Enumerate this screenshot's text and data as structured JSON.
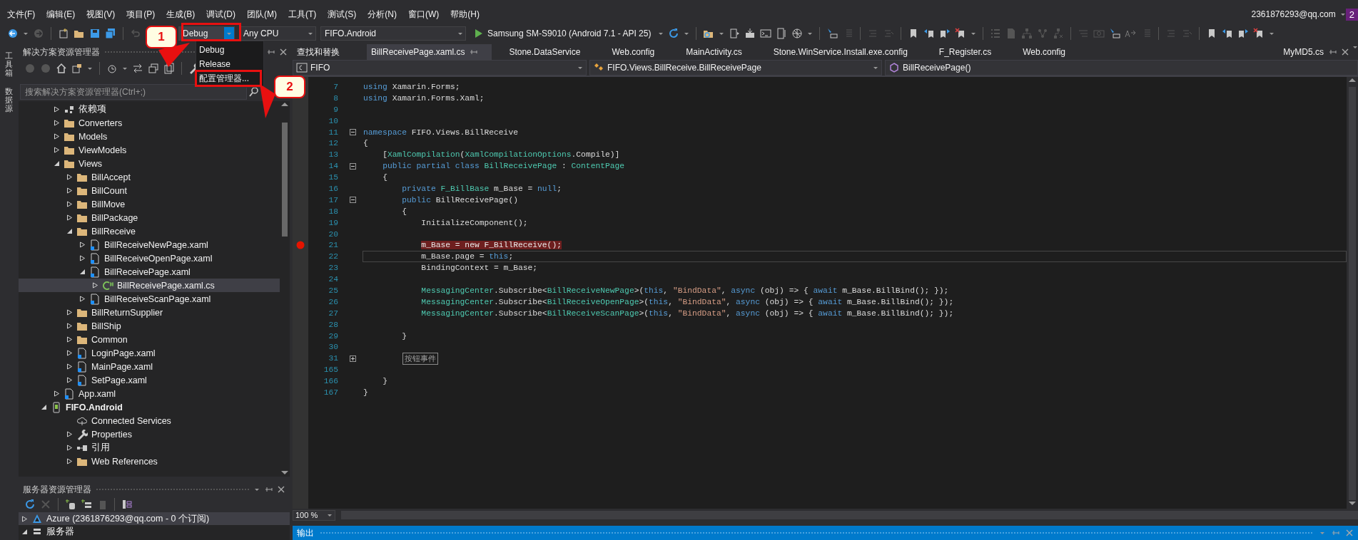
{
  "menu": [
    {
      "label": "文件(F)"
    },
    {
      "label": "编辑(E)"
    },
    {
      "label": "视图(V)"
    },
    {
      "label": "项目(P)"
    },
    {
      "label": "生成(B)"
    },
    {
      "label": "调试(D)"
    },
    {
      "label": "团队(M)"
    },
    {
      "label": "工具(T)"
    },
    {
      "label": "测试(S)"
    },
    {
      "label": "分析(N)"
    },
    {
      "label": "窗口(W)"
    },
    {
      "label": "帮助(H)"
    }
  ],
  "account": "2361876293@qq.com",
  "notification_badge": "2",
  "toolbar": {
    "configuration": "Debug",
    "platform": "Any CPU",
    "startup_project": "FIFO.Android",
    "run_target": "Samsung SM-S9010 (Android 7.1 - API 25)"
  },
  "config_menu": [
    {
      "label": "Debug",
      "framed": false
    },
    {
      "label": "Release",
      "framed": false
    },
    {
      "label": "配置管理器...",
      "framed": true
    }
  ],
  "callouts": [
    {
      "label": "1"
    },
    {
      "label": "2"
    }
  ],
  "side_strip": [
    {
      "label": "工具箱"
    },
    {
      "label": "数据源"
    }
  ],
  "solution_explorer": {
    "title": "解决方案资源管理器",
    "search": {
      "placeholder": "搜索解决方案资源管理器(Ctrl+;)"
    },
    "tree": [
      {
        "label": "依赖项",
        "kind": "deps",
        "expanded": false,
        "selected": false
      },
      {
        "label": "Converters",
        "kind": "folder",
        "expanded": false,
        "selected": false
      },
      {
        "label": "Models",
        "kind": "folder",
        "expanded": false,
        "selected": false
      },
      {
        "label": "ViewModels",
        "kind": "folder",
        "expanded": false,
        "selected": false
      },
      {
        "label": "Views",
        "kind": "folder",
        "expanded": true,
        "selected": false,
        "children": [
          {
            "label": "BillAccept",
            "kind": "folder",
            "expanded": false,
            "selected": false
          },
          {
            "label": "BillCount",
            "kind": "folder",
            "expanded": false,
            "selected": false
          },
          {
            "label": "BillMove",
            "kind": "folder",
            "expanded": false,
            "selected": false
          },
          {
            "label": "BillPackage",
            "kind": "folder",
            "expanded": false,
            "selected": false
          },
          {
            "label": "BillReceive",
            "kind": "folder",
            "expanded": true,
            "selected": false,
            "children": [
              {
                "label": "BillReceiveNewPage.xaml",
                "kind": "xaml",
                "expanded": false,
                "selected": false
              },
              {
                "label": "BillReceiveOpenPage.xaml",
                "kind": "xaml",
                "expanded": false,
                "selected": false
              },
              {
                "label": "BillReceivePage.xaml",
                "kind": "xaml",
                "expanded": true,
                "selected": false,
                "children": [
                  {
                    "label": "BillReceivePage.xaml.cs",
                    "kind": "csharp",
                    "expanded": false,
                    "selected": true
                  }
                ]
              },
              {
                "label": "BillReceiveScanPage.xaml",
                "kind": "xaml",
                "expanded": false,
                "selected": false
              }
            ]
          },
          {
            "label": "BillReturnSupplier",
            "kind": "folder",
            "expanded": false,
            "selected": false
          },
          {
            "label": "BillShip",
            "kind": "folder",
            "expanded": false,
            "selected": false
          },
          {
            "label": "Common",
            "kind": "folder",
            "expanded": false,
            "selected": false
          },
          {
            "label": "LoginPage.xaml",
            "kind": "xaml",
            "expanded": false,
            "selected": false
          },
          {
            "label": "MainPage.xaml",
            "kind": "xaml",
            "expanded": false,
            "selected": false
          },
          {
            "label": "SetPage.xaml",
            "kind": "xaml",
            "expanded": false,
            "selected": false
          }
        ]
      },
      {
        "label": "App.xaml",
        "kind": "xaml",
        "expanded": false,
        "selected": false
      },
      {
        "label": "FIFO.Android",
        "kind": "project",
        "expanded": true,
        "selected": false,
        "children": [
          {
            "label": "Connected Services",
            "kind": "cloud",
            "selected": false
          },
          {
            "label": "Properties",
            "kind": "wrench",
            "expanded": false,
            "selected": false
          },
          {
            "label": "引用",
            "kind": "refs",
            "expanded": false,
            "selected": false
          },
          {
            "label": "Web References",
            "kind": "folder",
            "expanded": false,
            "selected": false
          }
        ]
      }
    ]
  },
  "server_explorer": {
    "title": "服务器资源管理器",
    "tree": [
      {
        "label": "Azure (2361876293@qq.com - 0 个订阅)",
        "kind": "azure",
        "expanded": false,
        "selected": true
      },
      {
        "label": "服务器",
        "kind": "server",
        "expanded": true,
        "selected": false
      }
    ]
  },
  "editor": {
    "tabs": [
      {
        "label": "查找和替换",
        "selected": false,
        "pinned": false,
        "closable": false
      },
      {
        "label": "BillReceivePage.xaml.cs",
        "selected": true,
        "pinned": true,
        "closable": false
      },
      {
        "label": "Stone.DataService",
        "selected": false,
        "pinned": false,
        "closable": false
      },
      {
        "label": "Web.config",
        "selected": false,
        "pinned": false,
        "closable": false
      },
      {
        "label": "MainActivity.cs",
        "selected": false,
        "pinned": false,
        "closable": false
      },
      {
        "label": "Stone.WinService.Install.exe.config",
        "selected": false,
        "pinned": false,
        "closable": false
      },
      {
        "label": "F_Register.cs",
        "selected": false,
        "pinned": false,
        "closable": false
      },
      {
        "label": "Web.config",
        "selected": false,
        "pinned": false,
        "closable": false
      },
      {
        "label": "MyMD5.cs",
        "selected": false,
        "pinned": true,
        "closable": true
      }
    ],
    "nav": {
      "project": "FIFO",
      "type": "FIFO.Views.BillReceive.BillReceivePage",
      "member": "BillReceivePage()"
    },
    "lines": [
      {
        "number": "7",
        "breakpoint": false,
        "current": false,
        "tokens": [
          {
            "kind": "kw",
            "text": "using"
          },
          {
            "kind": "plain",
            "text": " Xamarin.Forms;"
          }
        ]
      },
      {
        "number": "8",
        "breakpoint": false,
        "current": false,
        "tokens": [
          {
            "kind": "kw",
            "text": "using"
          },
          {
            "kind": "plain",
            "text": " Xamarin.Forms.Xaml;"
          }
        ]
      },
      {
        "number": "9",
        "breakpoint": false,
        "current": false
      },
      {
        "number": "10",
        "breakpoint": false,
        "current": false
      },
      {
        "number": "11",
        "breakpoint": false,
        "current": false,
        "collapsed": false,
        "tokens": [
          {
            "kind": "kw",
            "text": "namespace"
          },
          {
            "kind": "plain",
            "text": " FIFO.Views.BillReceive"
          }
        ]
      },
      {
        "number": "12",
        "breakpoint": false,
        "current": false,
        "tokens": [
          {
            "kind": "plain",
            "text": "{"
          }
        ]
      },
      {
        "number": "13",
        "breakpoint": false,
        "current": false,
        "tokens": [
          {
            "kind": "plain",
            "text": "    ["
          },
          {
            "kind": "type",
            "text": "XamlCompilation"
          },
          {
            "kind": "plain",
            "text": "("
          },
          {
            "kind": "type",
            "text": "XamlCompilationOptions"
          },
          {
            "kind": "plain",
            "text": ".Compile)]"
          }
        ]
      },
      {
        "number": "14",
        "breakpoint": false,
        "current": false,
        "collapsed": false,
        "tokens": [
          {
            "kind": "kw",
            "text": "    public partial class"
          },
          {
            "kind": "type",
            "text": " BillReceivePage"
          },
          {
            "kind": "plain",
            "text": " : "
          },
          {
            "kind": "type",
            "text": "ContentPage"
          }
        ]
      },
      {
        "number": "15",
        "breakpoint": false,
        "current": false,
        "tokens": [
          {
            "kind": "plain",
            "text": "    {"
          }
        ]
      },
      {
        "number": "16",
        "breakpoint": false,
        "current": false,
        "tokens": [
          {
            "kind": "kw",
            "text": "        private"
          },
          {
            "kind": "type",
            "text": " F_BillBase"
          },
          {
            "kind": "plain",
            "text": " m_Base = "
          },
          {
            "kind": "kw",
            "text": "null"
          },
          {
            "kind": "plain",
            "text": ";"
          }
        ]
      },
      {
        "number": "17",
        "breakpoint": false,
        "current": false,
        "collapsed": false,
        "tokens": [
          {
            "kind": "kw",
            "text": "        public"
          },
          {
            "kind": "plain",
            "text": " BillReceivePage()"
          }
        ]
      },
      {
        "number": "18",
        "breakpoint": false,
        "current": false,
        "tokens": [
          {
            "kind": "plain",
            "text": "        {"
          }
        ]
      },
      {
        "number": "19",
        "breakpoint": false,
        "current": false,
        "tokens": [
          {
            "kind": "plain",
            "text": "            InitializeComponent();"
          }
        ]
      },
      {
        "number": "20",
        "breakpoint": false,
        "current": false
      },
      {
        "number": "21",
        "breakpoint": true,
        "current": false,
        "tokens": [
          {
            "kind": "hl",
            "text": "            m_Base = new F_BillReceive();"
          }
        ]
      },
      {
        "number": "22",
        "breakpoint": false,
        "current": true,
        "tokens": [
          {
            "kind": "plain",
            "text": "            m_Base.page = "
          },
          {
            "kind": "kw",
            "text": "this"
          },
          {
            "kind": "plain",
            "text": ";"
          }
        ]
      },
      {
        "number": "23",
        "breakpoint": false,
        "current": false,
        "tokens": [
          {
            "kind": "plain",
            "text": "            BindingContext = m_Base;"
          }
        ]
      },
      {
        "number": "24",
        "breakpoint": false,
        "current": false
      },
      {
        "number": "25",
        "breakpoint": false,
        "current": false,
        "tokens": [
          {
            "kind": "type",
            "text": "            MessagingCenter"
          },
          {
            "kind": "plain",
            "text": ".Subscribe<"
          },
          {
            "kind": "type",
            "text": "BillReceiveNewPage"
          },
          {
            "kind": "plain",
            "text": ">("
          },
          {
            "kind": "kw",
            "text": "this"
          },
          {
            "kind": "plain",
            "text": ", "
          },
          {
            "kind": "str",
            "text": "\"BindData\""
          },
          {
            "kind": "plain",
            "text": ", "
          },
          {
            "kind": "kw",
            "text": "async"
          },
          {
            "kind": "plain",
            "text": " (obj) => { "
          },
          {
            "kind": "kw",
            "text": "await"
          },
          {
            "kind": "plain",
            "text": " m_Base.BillBind(); });"
          }
        ]
      },
      {
        "number": "26",
        "breakpoint": false,
        "current": false,
        "tokens": [
          {
            "kind": "type",
            "text": "            MessagingCenter"
          },
          {
            "kind": "plain",
            "text": ".Subscribe<"
          },
          {
            "kind": "type",
            "text": "BillReceiveOpenPage"
          },
          {
            "kind": "plain",
            "text": ">("
          },
          {
            "kind": "kw",
            "text": "this"
          },
          {
            "kind": "plain",
            "text": ", "
          },
          {
            "kind": "str",
            "text": "\"BindData\""
          },
          {
            "kind": "plain",
            "text": ", "
          },
          {
            "kind": "kw",
            "text": "async"
          },
          {
            "kind": "plain",
            "text": " (obj) => { "
          },
          {
            "kind": "kw",
            "text": "await"
          },
          {
            "kind": "plain",
            "text": " m_Base.BillBind(); });"
          }
        ]
      },
      {
        "number": "27",
        "breakpoint": false,
        "current": false,
        "tokens": [
          {
            "kind": "type",
            "text": "            MessagingCenter"
          },
          {
            "kind": "plain",
            "text": ".Subscribe<"
          },
          {
            "kind": "type",
            "text": "BillReceiveScanPage"
          },
          {
            "kind": "plain",
            "text": ">("
          },
          {
            "kind": "kw",
            "text": "this"
          },
          {
            "kind": "plain",
            "text": ", "
          },
          {
            "kind": "str",
            "text": "\"BindData\""
          },
          {
            "kind": "plain",
            "text": ", "
          },
          {
            "kind": "kw",
            "text": "async"
          },
          {
            "kind": "plain",
            "text": " (obj) => { "
          },
          {
            "kind": "kw",
            "text": "await"
          },
          {
            "kind": "plain",
            "text": " m_Base.BillBind(); });"
          }
        ]
      },
      {
        "number": "28",
        "breakpoint": false,
        "current": false
      },
      {
        "number": "29",
        "breakpoint": false,
        "current": false,
        "tokens": [
          {
            "kind": "plain",
            "text": "        }"
          }
        ]
      },
      {
        "number": "30",
        "breakpoint": false,
        "current": false
      },
      {
        "number": "31",
        "breakpoint": false,
        "current": false,
        "collapsed": true,
        "tokens": [
          {
            "kind": "collapsed",
            "text": "按钮事件"
          }
        ]
      },
      {
        "number": "165",
        "breakpoint": false,
        "current": false
      },
      {
        "number": "166",
        "breakpoint": false,
        "current": false,
        "tokens": [
          {
            "kind": "plain",
            "text": "    }"
          }
        ]
      },
      {
        "number": "167",
        "breakpoint": false,
        "current": false,
        "tokens": [
          {
            "kind": "plain",
            "text": "}"
          }
        ]
      }
    ],
    "zoom": "100 %"
  },
  "output_panel": {
    "title": "输出"
  }
}
